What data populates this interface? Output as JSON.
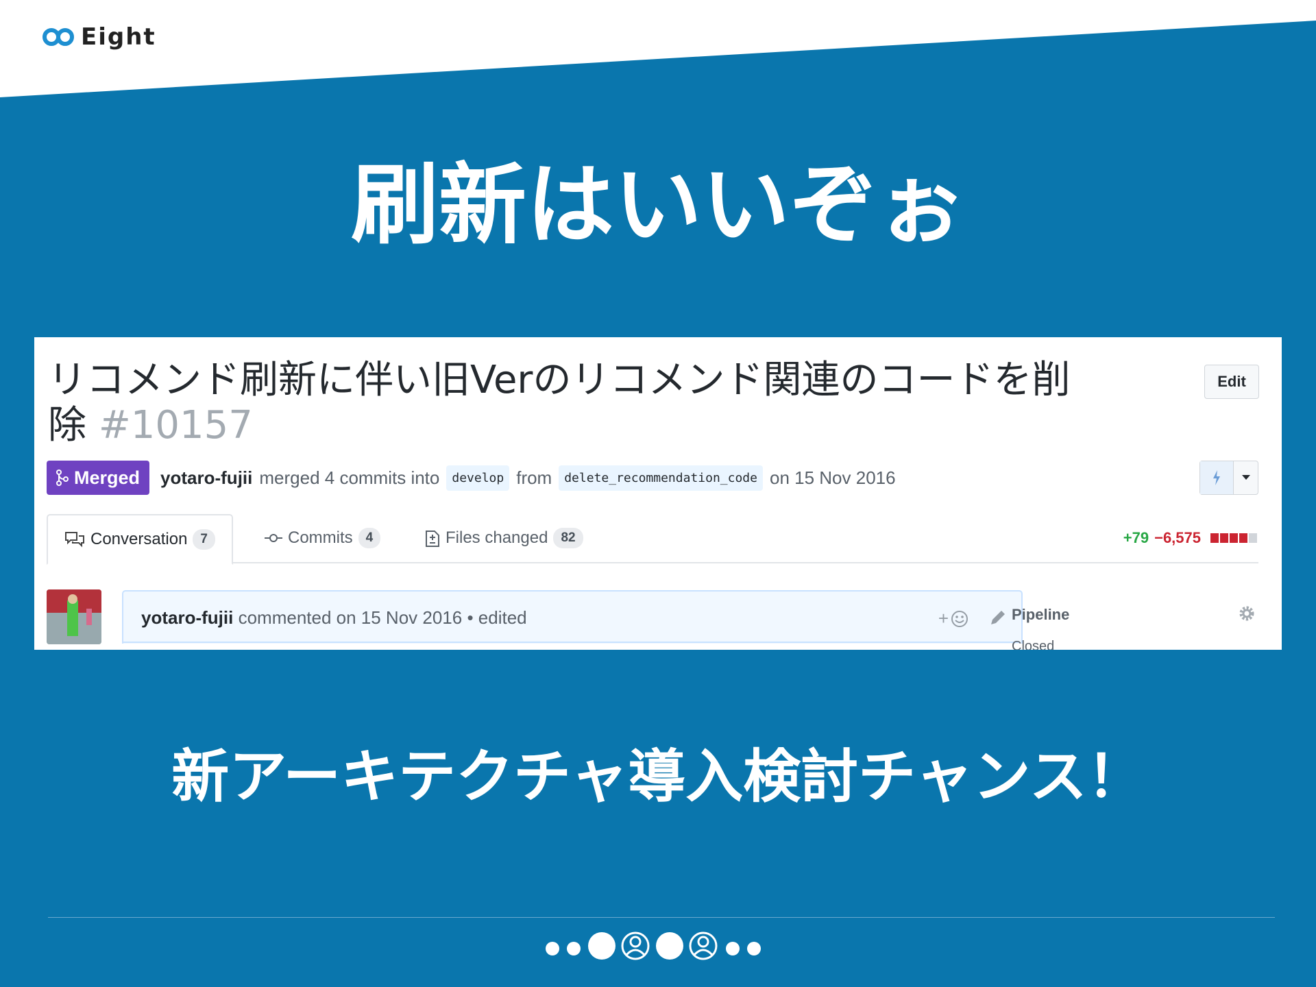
{
  "brand": {
    "name": "Eight"
  },
  "headline": "刷新はいいぞぉ",
  "pull_request": {
    "title": "リコメンド刷新に伴い旧Verのリコメンド関連のコードを削除",
    "number": "#10157",
    "edit_label": "Edit",
    "status_label": "Merged",
    "author": "yotaro-fujii",
    "merged_text": "merged 4 commits into",
    "base_branch": "develop",
    "from_text": "from",
    "head_branch": "delete_recommendation_code",
    "date_text": "on 15 Nov 2016",
    "tabs": [
      {
        "label": "Conversation",
        "count": "7",
        "icon": "comment-discussion-icon"
      },
      {
        "label": "Commits",
        "count": "4",
        "icon": "git-commit-icon"
      },
      {
        "label": "Files changed",
        "count": "82",
        "icon": "diff-icon"
      }
    ],
    "diffstat": {
      "additions": "+79",
      "deletions": "−6,575"
    },
    "comment": {
      "author": "yotaro-fujii",
      "meta": "commented on 15 Nov 2016 • edited",
      "reaction_label": "+"
    },
    "sidebar": {
      "title": "Pipeline",
      "value": "Closed"
    }
  },
  "subline": "新アーキテクチャ導入検討チャンス！",
  "colors": {
    "background": "#0a76ad",
    "merged": "#6f42c1",
    "additions": "#28a745",
    "deletions": "#cb2431"
  }
}
